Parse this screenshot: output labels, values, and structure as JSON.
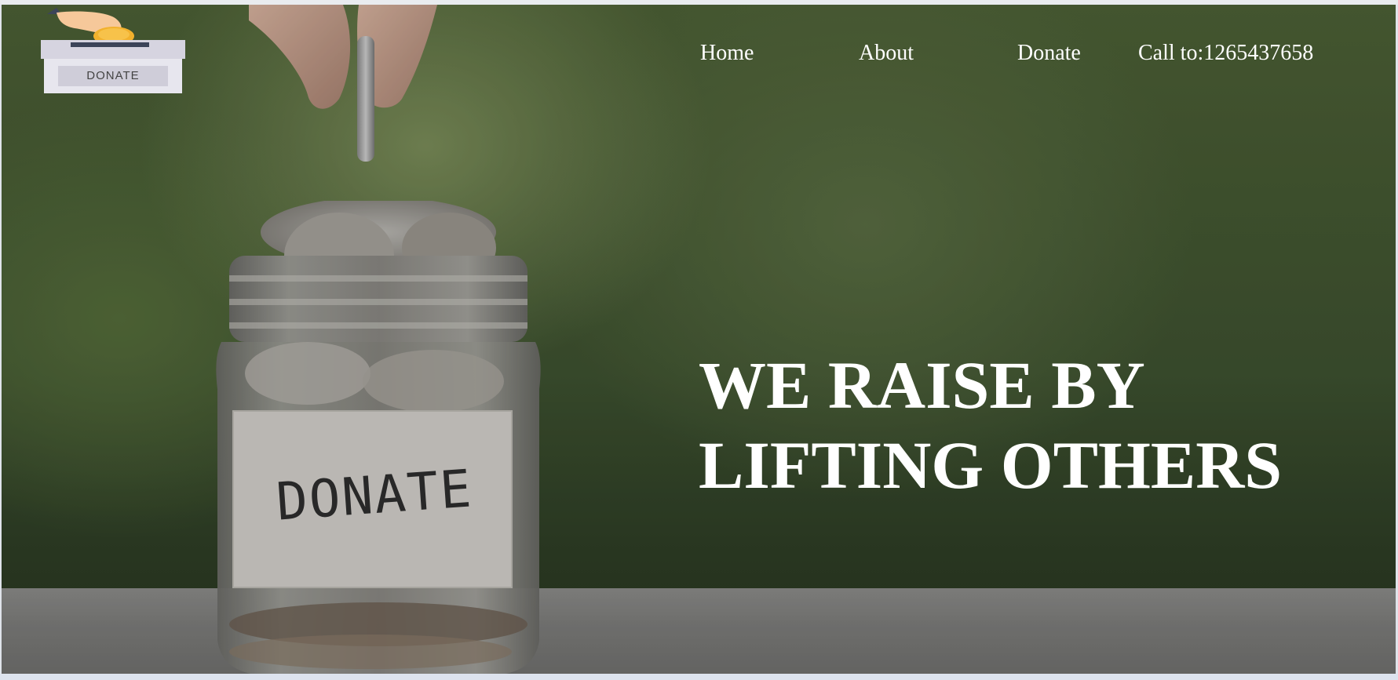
{
  "logo": {
    "box_label": "DONATE",
    "icon": "donation-box-icon"
  },
  "nav": {
    "items": [
      {
        "label": "Home"
      },
      {
        "label": "About"
      },
      {
        "label": "Donate"
      }
    ],
    "call": "Call to:1265437658"
  },
  "hero": {
    "headline_line1": "WE RAISE BY",
    "headline_line2": "LIFTING OTHERS",
    "jar_label": "DONATE",
    "image": "donation-jar-with-coins"
  },
  "colors": {
    "text": "#ffffff",
    "background_green": "#4d6136",
    "table_gray": "#7d7d7b"
  }
}
